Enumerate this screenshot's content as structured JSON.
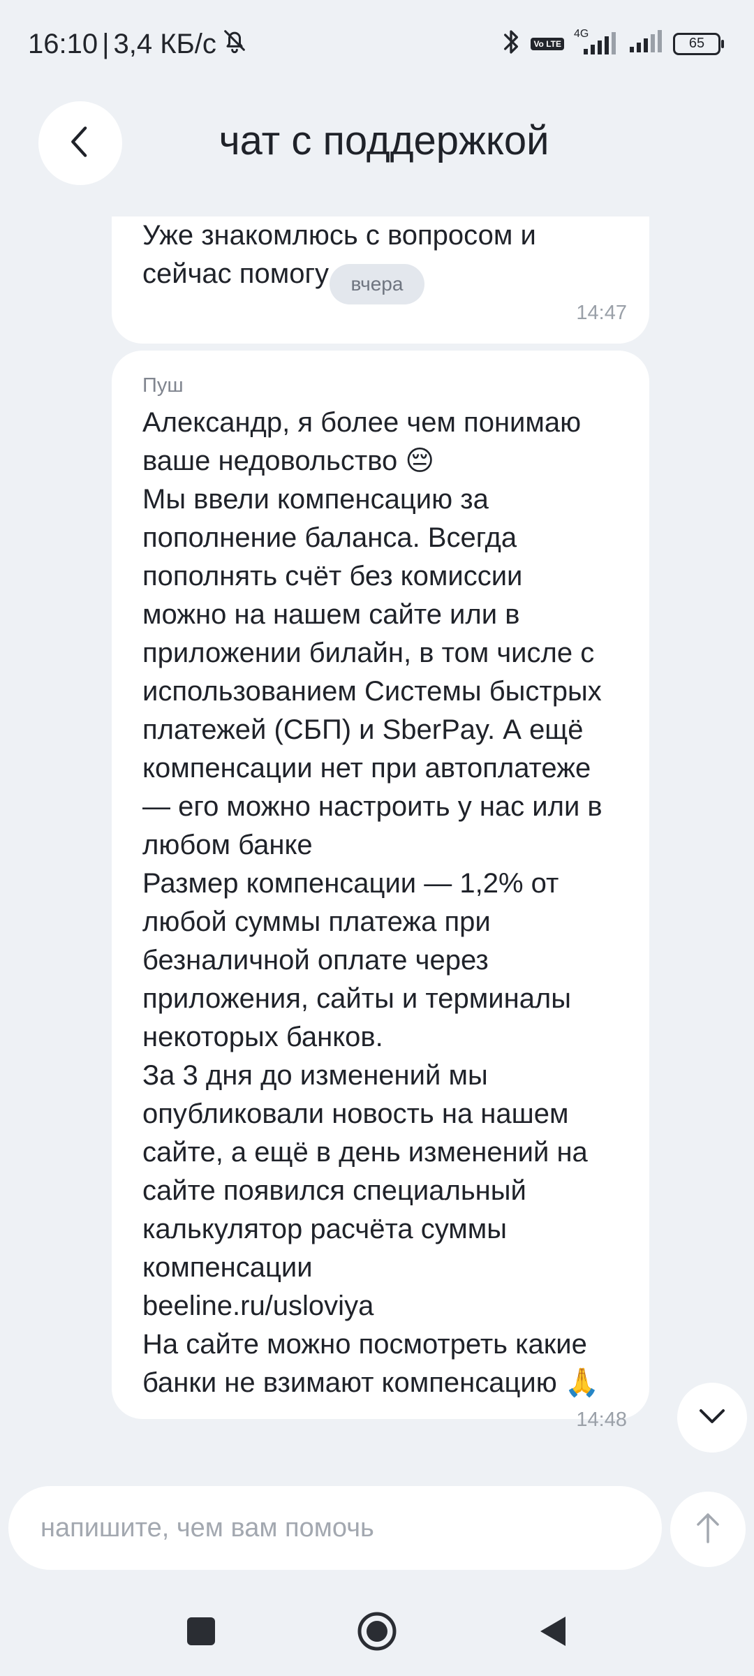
{
  "status_bar": {
    "time": "16:10",
    "separator": "|",
    "speed": "3,4 КБ/с",
    "network_label": "4G",
    "volte_label": "Vo LTE",
    "battery": "65"
  },
  "header": {
    "title": "чат с поддержкой"
  },
  "messages": [
    {
      "text": "Уже знакомлюсь с вопросом и\nсейчас помогу",
      "time": "14:47"
    },
    {
      "sender": "Пуш",
      "text": "Александр, я более чем понимаю\nваше недовольство 😔\nМы ввели компенсацию за\nпополнение баланса. Всегда\nпополнять счёт без комиссии\nможно на нашем сайте или в\nприложении билайн, в том числе с\nиспользованием Системы быстрых\nплатежей (СБП) и SberPay. А ещё\nкомпенсации нет при автоплатеже\n— его можно настроить у нас или в\nлюбом банке\nРазмер компенсации — 1,2% от\nлюбой суммы платежа при\nбезналичной оплате через\nприложения, сайты и терминалы\nнекоторых банков.\nЗа 3 дня до изменений мы\nопубликовали новость на нашем\nсайте, а ещё в день изменений на\nсайте появился специальный\nкалькулятор расчёта суммы\nкомпенсации\nbeeline.ru/usloviya\nНа сайте можно посмотреть какие\nбанки не взимают компенсацию 🙏",
      "time": "14:48"
    }
  ],
  "date_chip": "вчера",
  "composer": {
    "placeholder": "напишите, чем вам помочь",
    "value": ""
  },
  "icons": {
    "back": "chevron-left-icon",
    "scroll_down": "chevron-down-icon",
    "send": "arrow-up-icon",
    "mute": "bell-off-icon",
    "bluetooth": "bluetooth-icon"
  },
  "colors": {
    "background": "#eef1f5",
    "bubble": "#ffffff",
    "text": "#1f2229",
    "muted": "#9aa0a8"
  }
}
